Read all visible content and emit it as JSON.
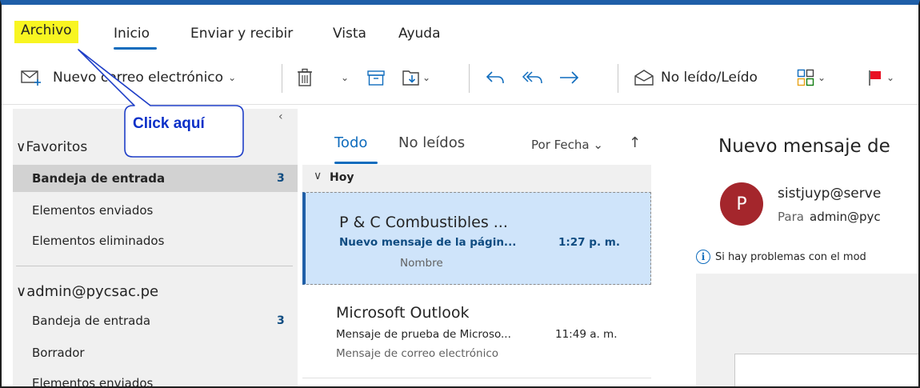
{
  "menu": {
    "archivo": "Archivo",
    "inicio": "Inicio",
    "enviar": "Enviar y recibir",
    "vista": "Vista",
    "ayuda": "Ayuda"
  },
  "toolbar": {
    "new_email": "Nuevo correo electrónico",
    "read_unread": "No leído/Leído"
  },
  "folders": {
    "favorites_label": "Favoritos",
    "favorites": [
      {
        "label": "Bandeja de entrada",
        "count": "3"
      },
      {
        "label": "Elementos enviados"
      },
      {
        "label": "Elementos eliminados"
      }
    ],
    "account_label": "admin@pycsac.pe",
    "account_items": [
      {
        "label": "Bandeja de entrada",
        "count": "3"
      },
      {
        "label": "Borrador"
      },
      {
        "label": "Elementos enviados"
      }
    ]
  },
  "list": {
    "filter_all": "Todo",
    "filter_unread": "No leídos",
    "sort": "Por Fecha",
    "group": "Hoy",
    "messages": [
      {
        "sender": "P & C Combustibles ...",
        "subject": "Nuevo mensaje de la págin...",
        "time": "1:27 p. m.",
        "preview": "Nombre"
      },
      {
        "sender": "Microsoft Outlook",
        "subject": "Mensaje de prueba de Microso...",
        "time": "11:49 a. m.",
        "preview": "Mensaje de correo electrónico"
      }
    ]
  },
  "reading": {
    "subject": "Nuevo mensaje de",
    "avatar_initial": "P",
    "from": "sistjuyp@serve",
    "to_label": "Para",
    "to": "admin@pyc",
    "info": "Si hay problemas con el mod"
  },
  "callout": {
    "text": "Click aquí"
  },
  "colors": {
    "accent": "#0f6cbd",
    "highlight": "#f8f521",
    "selected_message": "#cfe4fa",
    "avatar": "#a4262c",
    "flag": "#e81123",
    "callout_text": "#0b30c8"
  }
}
